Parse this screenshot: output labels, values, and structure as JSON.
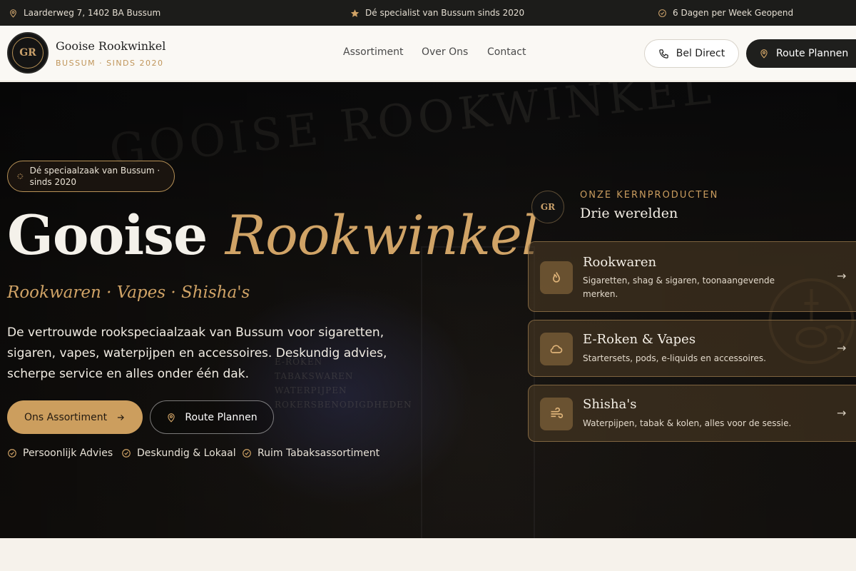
{
  "topbar": {
    "address": "Laarderweg 7, 1402 BA Bussum",
    "specialist": "Dé specialist van Bussum sinds 2020",
    "hours": "6 Dagen per Week Geopend"
  },
  "header": {
    "logo_mark": "GR",
    "brand_name": "Gooise Rookwinkel",
    "brand_sub": "BUSSUM · SINDS 2020",
    "nav": [
      "Assortiment",
      "Over Ons",
      "Contact"
    ],
    "call_label": "Bel Direct",
    "route_label": "Route Plannen"
  },
  "hero": {
    "badge": "Dé speciaalzaak van Bussum · sinds 2020",
    "title_main": "Gooise",
    "title_accent": "Rookwinkel",
    "subtitle": "Rookwaren · Vapes · Shisha's",
    "description": "De vertrouwde rookspeciaalzaak van Bussum voor sigaretten, sigaren, vapes, waterpijpen en accessoires. Deskundig advies, scherpe service en alles onder één dak.",
    "primary_cta": "Ons Assortiment",
    "secondary_cta": "Route Plannen",
    "checks": [
      "Persoonlijk Advies",
      "Deskundig & Lokaal",
      "Ruim Tabaksassortiment"
    ]
  },
  "kern": {
    "eyebrow": "ONZE KERNPRODUCTEN",
    "title": "Drie werelden",
    "cards": [
      {
        "title": "Rookwaren",
        "desc": "Sigaretten, shag & sigaren, toonaangevende merken.",
        "icon": "flame-icon"
      },
      {
        "title": "E-Roken & Vapes",
        "desc": "Startersets, pods, e-liquids en accessoires.",
        "icon": "cloud-icon"
      },
      {
        "title": "Shisha's",
        "desc": "Waterpijpen, tabak & kolen, alles voor de sessie.",
        "icon": "wind-icon"
      }
    ]
  },
  "colors": {
    "gold": "#cc9e5e",
    "dark": "#1c1c1a",
    "cream": "#f6f2eb"
  }
}
